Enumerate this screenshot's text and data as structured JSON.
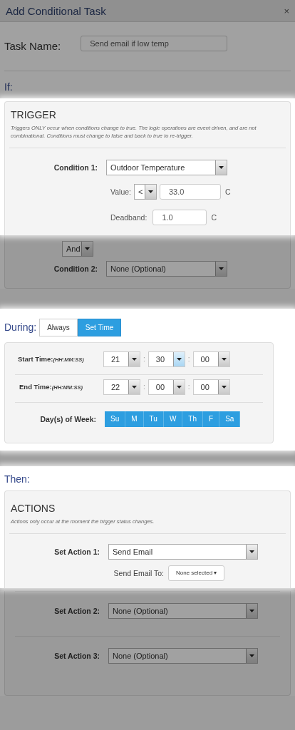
{
  "dialog": {
    "title": "Add Conditional Task",
    "close": "×",
    "highlighted": false
  },
  "task_name": {
    "label": "Task Name:",
    "value": "Send email if low temp",
    "highlighted": false
  },
  "if_heading": {
    "text": "If:",
    "highlighted": false
  },
  "trigger": {
    "title": "TRIGGER",
    "note": "Triggers ONLY occur when conditions change to true. The logic operations are event driven, and are not combinational. Conditions must change to false and back to true to re-trigger.",
    "highlighted": true,
    "condition_1": {
      "label": "Condition 1:",
      "value": "Outdoor Temperature"
    },
    "value": {
      "label": "Value:",
      "operator": "<",
      "amount": "33.0",
      "unit": "C"
    },
    "deadband": {
      "label": "Deadband:",
      "amount": "1.0",
      "unit": "C"
    }
  },
  "trigger_more": {
    "highlighted": false,
    "logic": "And",
    "condition_2": {
      "label": "Condition 2:",
      "value": "None (Optional)"
    }
  },
  "during": {
    "heading": "During:",
    "highlighted": true,
    "modes": [
      {
        "label": "Always",
        "selected": false
      },
      {
        "label": "Set Time",
        "selected": true
      }
    ],
    "times": [
      {
        "label": "Start Time:",
        "hint": "(HH:MM:SS)",
        "parts": [
          {
            "value": "21",
            "hovered": false
          },
          {
            "value": "30",
            "hovered": true
          },
          {
            "value": "00",
            "hovered": false
          }
        ]
      },
      {
        "label": "End Time:",
        "hint": "(HH:MM:SS)",
        "parts": [
          {
            "value": "22",
            "hovered": false
          },
          {
            "value": "00",
            "hovered": false
          },
          {
            "value": "00",
            "hovered": false
          }
        ]
      }
    ],
    "separator": ":",
    "days_label": "Day(s) of Week:",
    "days": [
      {
        "label": "Su",
        "selected": true
      },
      {
        "label": "M",
        "selected": true
      },
      {
        "label": "Tu",
        "selected": true
      },
      {
        "label": "W",
        "selected": true
      },
      {
        "label": "Th",
        "selected": true
      },
      {
        "label": "F",
        "selected": true
      },
      {
        "label": "Sa",
        "selected": true
      }
    ]
  },
  "then": {
    "heading": "Then:",
    "title": "ACTIONS",
    "note": "Actions only occur at the moment the trigger status changes.",
    "highlighted": true,
    "action_1": {
      "label": "Set Action 1:",
      "value": "Send Email"
    },
    "email_to": {
      "label": "Send Email To:",
      "value": "None selected",
      "caret": "▾"
    }
  },
  "more_actions": {
    "highlighted": false,
    "actions": [
      {
        "label": "Set Action 2:",
        "value": "None (Optional)"
      },
      {
        "label": "Set Action 3:",
        "value": "None (Optional)"
      }
    ]
  }
}
